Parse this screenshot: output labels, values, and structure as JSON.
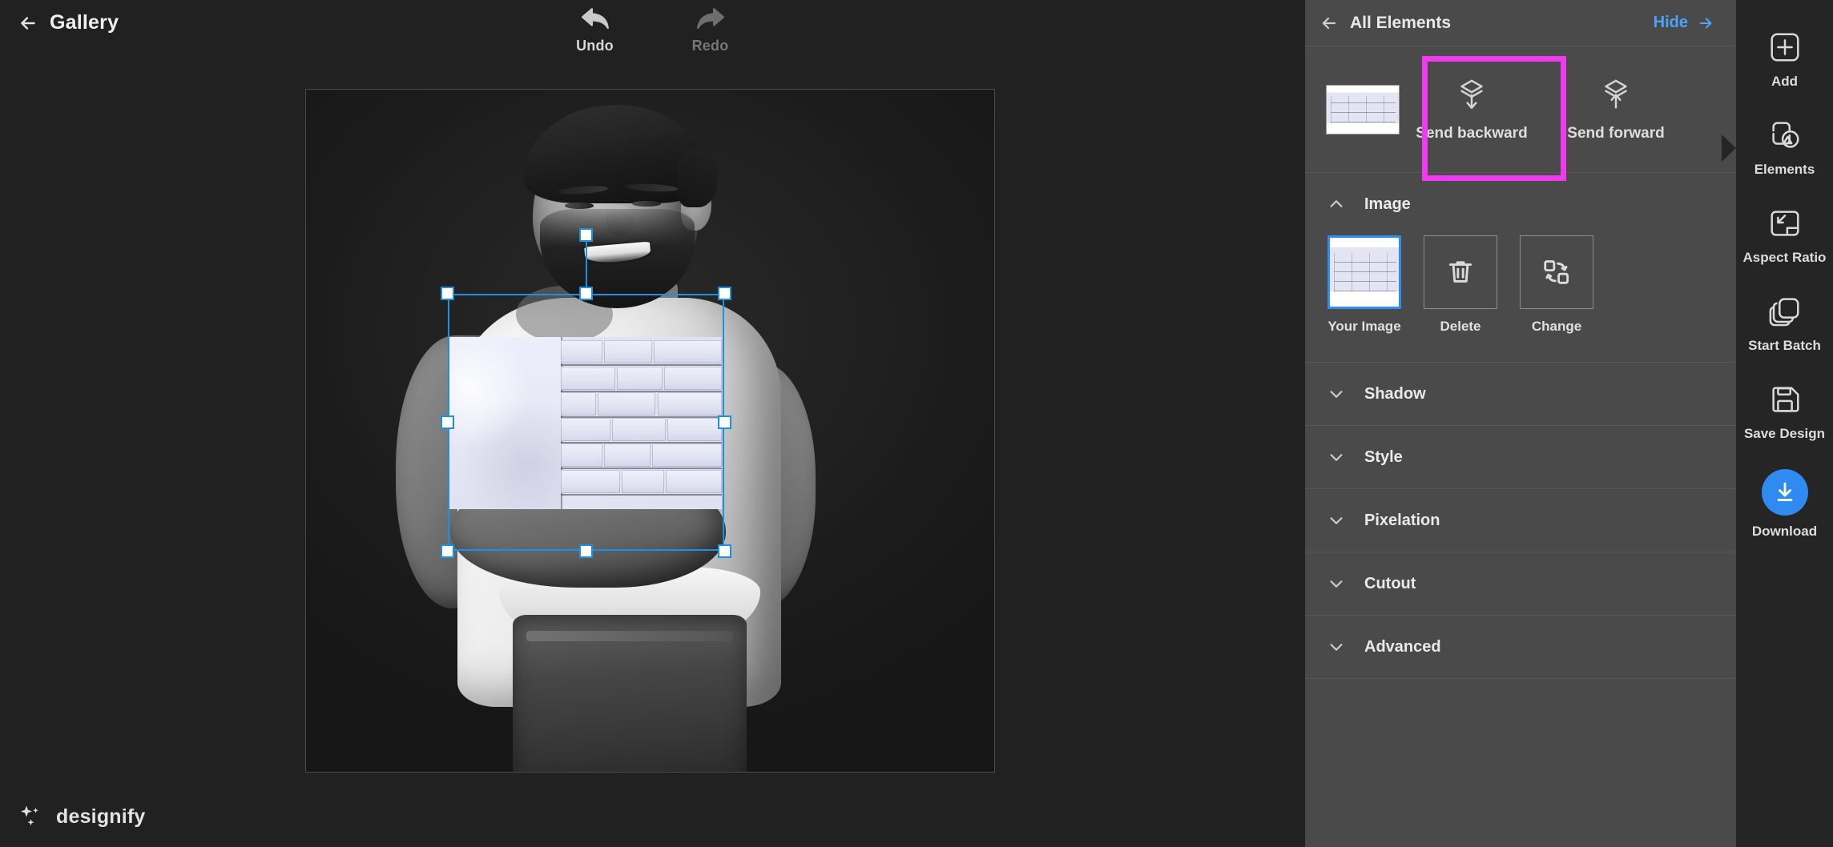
{
  "topbar": {
    "back_label": "Gallery",
    "back_icon": "arrow-left-icon",
    "undo": {
      "label": "Undo",
      "icon": "undo-arrow-icon",
      "state": "enabled"
    },
    "redo": {
      "label": "Redo",
      "icon": "redo-arrow-icon",
      "state": "disabled"
    }
  },
  "canvas": {
    "subject_alt": "black and white photo of smiling bearded man in white t-shirt",
    "selected_element_alt": "white brick wall image",
    "selection": {
      "handles": 8,
      "rotation_handle": true,
      "handle_color": "#1f8fe0"
    }
  },
  "brand": {
    "name": "designify",
    "icon": "sparkles-icon"
  },
  "panel": {
    "header": {
      "back_icon": "arrow-left-icon",
      "title": "All Elements",
      "hide_label": "Hide",
      "hide_icon": "arrow-right-icon"
    },
    "order_row": {
      "thumbnail_alt": "white brick wall thumbnail",
      "buttons": [
        {
          "label": "Send backward",
          "icon": "send-backward-icon",
          "highlighted": true
        },
        {
          "label": "Send forward",
          "icon": "send-forward-icon",
          "highlighted": false
        }
      ],
      "highlight_color": "#ef3aef"
    },
    "sections": [
      {
        "title": "Image",
        "expanded": true,
        "chevron": "chevron-up-icon"
      },
      {
        "title": "Shadow",
        "expanded": false,
        "chevron": "chevron-down-icon"
      },
      {
        "title": "Style",
        "expanded": false,
        "chevron": "chevron-down-icon"
      },
      {
        "title": "Pixelation",
        "expanded": false,
        "chevron": "chevron-down-icon"
      },
      {
        "title": "Cutout",
        "expanded": false,
        "chevron": "chevron-down-icon"
      },
      {
        "title": "Advanced",
        "expanded": false,
        "chevron": "chevron-down-icon"
      }
    ],
    "image_tiles": [
      {
        "label": "Your Image",
        "icon": "image-thumbnail",
        "selected": true
      },
      {
        "label": "Delete",
        "icon": "trash-icon",
        "selected": false
      },
      {
        "label": "Change",
        "icon": "swap-shapes-icon",
        "selected": false
      }
    ],
    "selected_tile_color": "#2d8df0"
  },
  "toolbar": {
    "items": [
      {
        "label": "Add",
        "icon": "plus-square-icon",
        "active": false
      },
      {
        "label": "Elements",
        "icon": "shapes-icon",
        "active": true
      },
      {
        "label": "Aspect Ratio",
        "icon": "aspect-ratio-icon",
        "active": false
      },
      {
        "label": "Start Batch",
        "icon": "stacked-layers-icon",
        "active": false
      },
      {
        "label": "Save Design",
        "icon": "floppy-disk-icon",
        "active": false
      },
      {
        "label": "Download",
        "icon": "download-arrow-icon",
        "active": false
      }
    ],
    "download_button_color": "#2f8bf0"
  }
}
